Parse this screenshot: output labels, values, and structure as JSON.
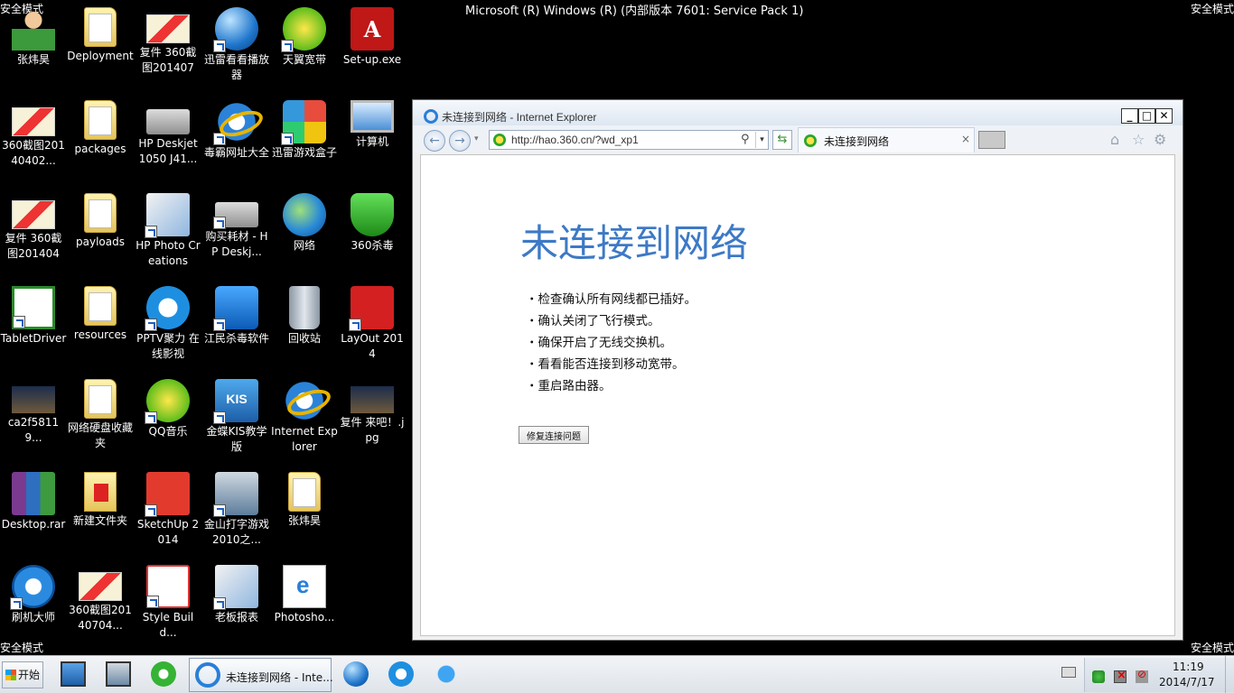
{
  "corners": {
    "safe_mode_label": "安全模式"
  },
  "os_title": "Microsoft (R) Windows (R) (内部版本 7601: Service Pack 1)",
  "desktop_icons": [
    {
      "label": "张炜昊",
      "icon": "user-folder-icon"
    },
    {
      "label": "Deployment",
      "icon": "folder-icon"
    },
    {
      "label": "复件 360截图2014070...",
      "icon": "image-icon"
    },
    {
      "label": "迅雷看看播放器",
      "icon": "xunlei-player-icon"
    },
    {
      "label": "天翼宽带",
      "icon": "tianyi-broadband-icon"
    },
    {
      "label": "Set-up.exe",
      "icon": "adobe-setup-icon"
    },
    {
      "label": "360截图20140402...",
      "icon": "image-icon"
    },
    {
      "label": "packages",
      "icon": "folder-icon"
    },
    {
      "label": "HP Deskjet 1050 J41...",
      "icon": "printer-icon"
    },
    {
      "label": "毒霸网址大全",
      "icon": "ie-icon"
    },
    {
      "label": "迅雷游戏盒子",
      "icon": "game-box-icon"
    },
    {
      "label": "计算机",
      "icon": "computer-icon"
    },
    {
      "label": "复件 360截图2014040...",
      "icon": "image-icon"
    },
    {
      "label": "payloads",
      "icon": "folder-icon"
    },
    {
      "label": "HP Photo Creations",
      "icon": "photo-icon"
    },
    {
      "label": "购买耗材 - HP Deskj...",
      "icon": "printer-icon"
    },
    {
      "label": "网络",
      "icon": "network-globe-icon"
    },
    {
      "label": "360杀毒",
      "icon": "shield-icon"
    },
    {
      "label": "TabletDriver",
      "icon": "tablet-icon"
    },
    {
      "label": "resources",
      "icon": "folder-icon"
    },
    {
      "label": "PPTV聚力 在线影视",
      "icon": "pptv-icon"
    },
    {
      "label": "江民杀毒软件",
      "icon": "jiangmin-icon"
    },
    {
      "label": "回收站",
      "icon": "recycle-bin-icon"
    },
    {
      "label": "LayOut 2014",
      "icon": "layout-icon"
    },
    {
      "label": "ca2f58119...",
      "icon": "movie-image-icon"
    },
    {
      "label": "网络硬盘收藏夹",
      "icon": "folder-icon"
    },
    {
      "label": "QQ音乐",
      "icon": "qq-music-icon"
    },
    {
      "label": "金蝶KIS教学版",
      "icon": "kis-icon"
    },
    {
      "label": "Internet Explorer",
      "icon": "ie-icon"
    },
    {
      "label": "复件 来吧！.jpg",
      "icon": "image-icon"
    },
    {
      "label": "Desktop.rar",
      "icon": "rar-archive-icon"
    },
    {
      "label": "新建文件夹",
      "icon": "folder-icon"
    },
    {
      "label": "SketchUp 2014",
      "icon": "sketchup-icon"
    },
    {
      "label": "金山打字游戏2010之...",
      "icon": "typing-game-icon"
    },
    {
      "label": "张炜昊",
      "icon": "folder-icon"
    },
    {
      "label": "刷机大师",
      "icon": "flash-master-icon"
    },
    {
      "label": "360截图20140704...",
      "icon": "image-icon"
    },
    {
      "label": "Style Build...",
      "icon": "style-builder-icon"
    },
    {
      "label": "老板报表",
      "icon": "report-icon"
    },
    {
      "label": "Photosho...",
      "icon": "ie-document-icon"
    }
  ],
  "ie": {
    "window_title": "未连接到网络 - Internet Explorer",
    "minimize": "_",
    "maximize": "□",
    "close": "✕",
    "back_glyph": "←",
    "forward_glyph": "→",
    "address": "http://hao.360.cn/?wd_xp1",
    "search_glyph": "⚲",
    "dropdown_glyph": "▾",
    "refresh_glyph": "⇆",
    "tab_title": "未连接到网络",
    "tab_close": "×",
    "home_glyph": "⌂",
    "favorites_glyph": "☆",
    "settings_glyph": "⚙",
    "page": {
      "heading": "未连接到网络",
      "checklist": [
        "检查确认所有网线都已插好。",
        "确认关闭了飞行模式。",
        "确保开启了无线交换机。",
        "看看能否连接到移动宽带。",
        "重启路由器。"
      ],
      "fix_button": "修复连接问题"
    }
  },
  "taskbar": {
    "start_label": "开始",
    "ie_task_label": "未连接到网络 - Inte...",
    "clock_time": "11:19",
    "clock_date": "2014/7/17"
  }
}
